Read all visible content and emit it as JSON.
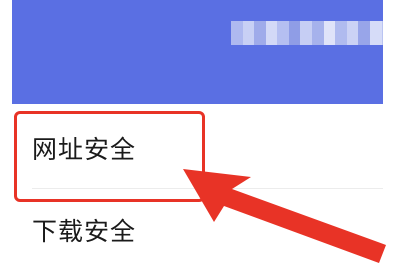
{
  "header": {
    "title_redacted": true,
    "background_color": "#5a6fe3"
  },
  "menu": {
    "items": [
      {
        "label": "网址安全",
        "highlighted": true
      },
      {
        "label": "下载安全",
        "highlighted": false
      }
    ]
  },
  "annotation": {
    "highlight_color": "#e83326",
    "arrow_color": "#e83326"
  }
}
